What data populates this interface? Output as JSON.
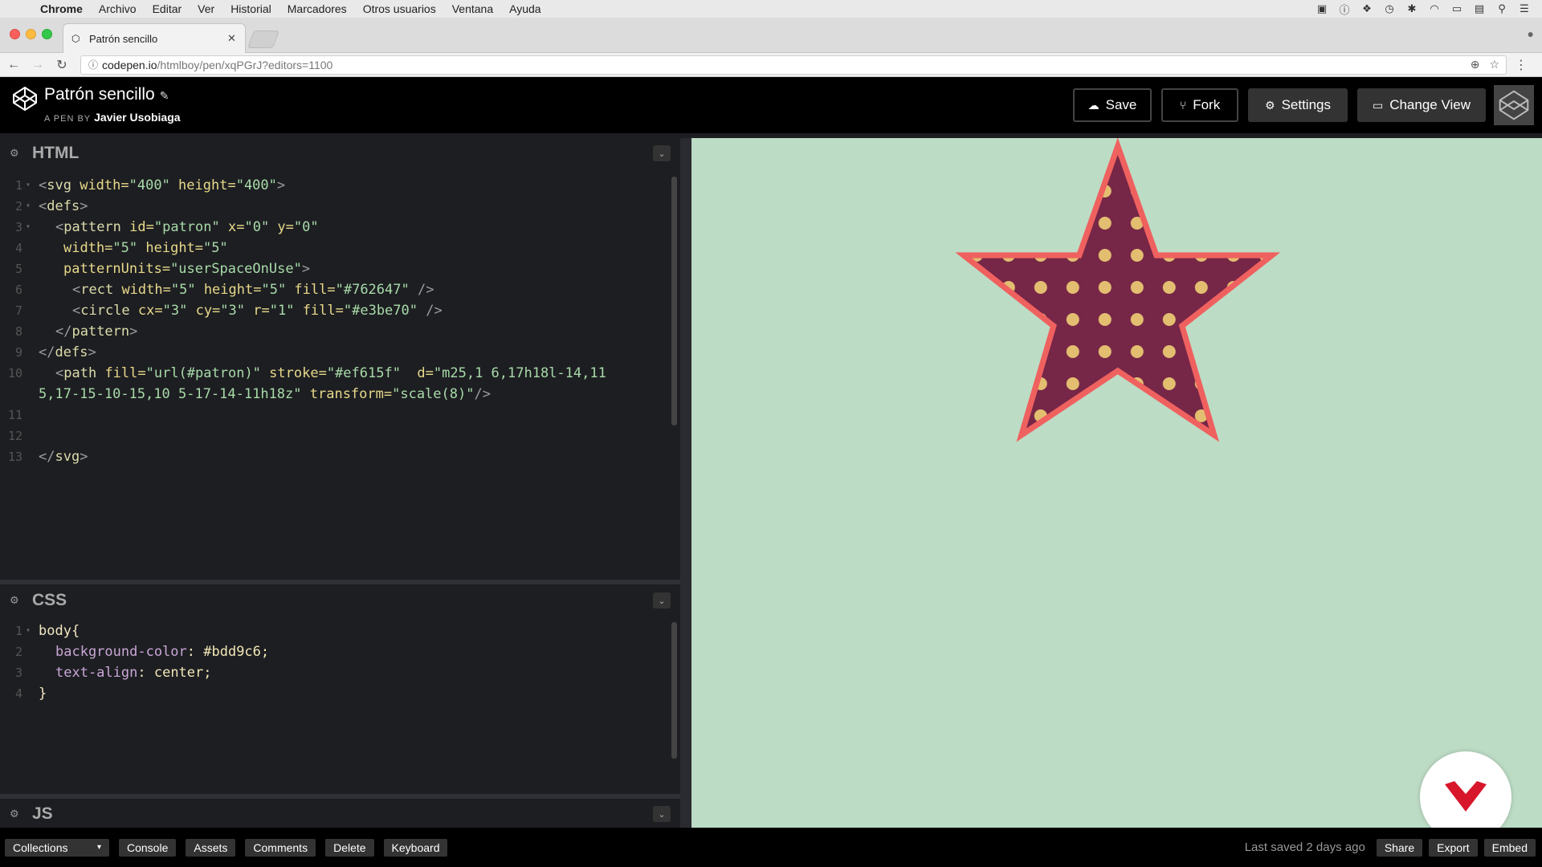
{
  "menubar": {
    "app": "Chrome",
    "items": [
      "Archivo",
      "Editar",
      "Ver",
      "Historial",
      "Marcadores",
      "Otros usuarios",
      "Ventana",
      "Ayuda"
    ]
  },
  "browser": {
    "tab_title": "Patrón sencillo",
    "url_host": "codepen.io",
    "url_path": "/htmlboy/pen/xqPGrJ?editors=1100"
  },
  "header": {
    "pen_title": "Patrón sencillo",
    "by_label": "A PEN BY",
    "author": "Javier Usobiaga",
    "save_label": "Save",
    "fork_label": "Fork",
    "settings_label": "Settings",
    "change_view_label": "Change View"
  },
  "editors": {
    "html_title": "HTML",
    "css_title": "CSS",
    "js_title": "JS"
  },
  "html_code": {
    "line_numbers": [
      "1",
      "2",
      "3",
      "4",
      "5",
      "6",
      "7",
      "8",
      "9",
      "10",
      "",
      "11",
      "12",
      "13"
    ],
    "l1": {
      "open": "<",
      "tag": "svg",
      "a1": " width=",
      "v1": "\"400\"",
      "a2": " height=",
      "v2": "\"400\"",
      "close": ">"
    },
    "l2": {
      "open": "<",
      "tag": "defs",
      "close": ">"
    },
    "l3": {
      "open": "<",
      "tag": "pattern",
      "a1": " id=",
      "v1": "\"patron\"",
      "a2": " x=",
      "v2": "\"0\"",
      "a3": " y=",
      "v3": "\"0\""
    },
    "l4": {
      "a1": "width=",
      "v1": "\"5\"",
      "a2": " height=",
      "v2": "\"5\""
    },
    "l5": {
      "a1": "patternUnits=",
      "v1": "\"userSpaceOnUse\"",
      "close": ">"
    },
    "l6": {
      "open": "<",
      "tag": "rect",
      "a1": " width=",
      "v1": "\"5\"",
      "a2": " height=",
      "v2": "\"5\"",
      "a3": " fill=",
      "v3": "\"#762647\"",
      "close": " />"
    },
    "l7": {
      "open": "<",
      "tag": "circle",
      "a1": " cx=",
      "v1": "\"3\"",
      "a2": " cy=",
      "v2": "\"3\"",
      "a3": " r=",
      "v3": "\"1\"",
      "a4": " fill=",
      "v4": "\"#e3be70\"",
      "close": " />"
    },
    "l8": {
      "open": "</",
      "tag": "pattern",
      "close": ">"
    },
    "l9": {
      "open": "</",
      "tag": "defs",
      "close": ">"
    },
    "l10": {
      "open": "<",
      "tag": "path",
      "a1": " fill=",
      "v1": "\"url(#patron)\"",
      "a2": " stroke=",
      "v2": "\"#ef615f\"",
      "a3": "  d=",
      "v3": "\"m25,1 6,17h18l-14,11"
    },
    "l10b": {
      "v3b": "5,17-15-10-15,10 5-17-14-11h18z\"",
      "a4": " transform=",
      "v4": "\"scale(8)\"",
      "close": "/>"
    },
    "l13": {
      "open": "</",
      "tag": "svg",
      "close": ">"
    }
  },
  "css_code": {
    "line_numbers": [
      "1",
      "2",
      "3",
      "4"
    ],
    "selector": "body{",
    "p1": "background-color",
    "v1": "#bdd9c6;",
    "p2": "text-align",
    "v2": "center;",
    "close": "}"
  },
  "preview": {
    "background": "#bddcc5",
    "pattern_fill": "#762647",
    "dot_fill": "#e3be70",
    "stroke": "#ef615f"
  },
  "footer": {
    "collections_label": "Collections",
    "console_label": "Console",
    "assets_label": "Assets",
    "comments_label": "Comments",
    "delete_label": "Delete",
    "keyboard_label": "Keyboard",
    "saved_text": "Last saved 2 days ago",
    "share_label": "Share",
    "export_label": "Export",
    "embed_label": "Embed"
  }
}
